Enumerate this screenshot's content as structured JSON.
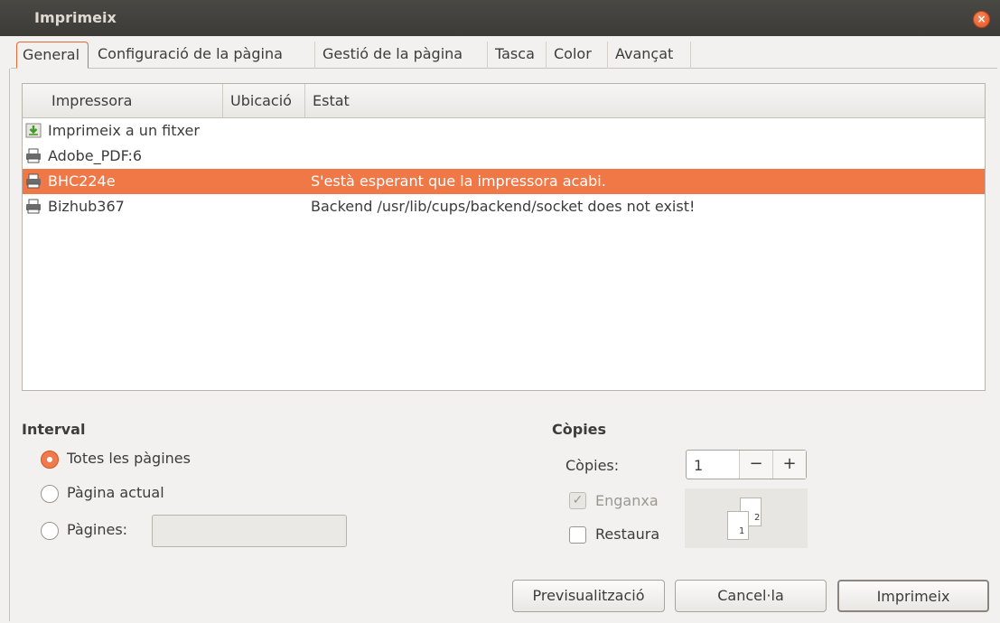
{
  "window": {
    "title": "Imprimeix",
    "close_icon": "×"
  },
  "tabs": [
    {
      "label": "General"
    },
    {
      "label": "Configuració de la pàgina"
    },
    {
      "label": "Gestió de la pàgina"
    },
    {
      "label": "Tasca"
    },
    {
      "label": "Color"
    },
    {
      "label": "Avançat"
    }
  ],
  "printer_list": {
    "columns": [
      "Impressora",
      "Ubicació",
      "Estat"
    ],
    "rows": [
      {
        "name": "Imprimeix a un fitxer",
        "location": "",
        "state": "",
        "icon": "file-download-icon"
      },
      {
        "name": "Adobe_PDF:6",
        "location": "",
        "state": "",
        "icon": "printer-icon"
      },
      {
        "name": "BHC224e",
        "location": "",
        "state": "S'està esperant que la impressora acabi.",
        "icon": "printer-icon",
        "selected": true
      },
      {
        "name": "Bizhub367",
        "location": "",
        "state": "Backend /usr/lib/cups/backend/socket does not exist!",
        "icon": "printer-icon"
      }
    ]
  },
  "range": {
    "heading": "Interval",
    "options": [
      {
        "label": "Totes les pàgines",
        "checked": true
      },
      {
        "label": "Pàgina actual",
        "checked": false
      },
      {
        "label": "Pàgines:",
        "checked": false
      }
    ],
    "pages_value": ""
  },
  "copies": {
    "heading": "Còpies",
    "label": "Còpies:",
    "value": "1",
    "minus": "−",
    "plus": "+",
    "collate_label": "Enganxa",
    "collate_checked": true,
    "collate_enabled": false,
    "reverse_label": "Restaura",
    "reverse_checked": false,
    "sheet_labels": [
      "1",
      "2"
    ]
  },
  "buttons": {
    "preview": "Previsualització",
    "cancel": "Cancel·la",
    "print": "Imprimeix"
  },
  "colors": {
    "accent": "#f07746",
    "titlebar": "#3c3b37"
  }
}
